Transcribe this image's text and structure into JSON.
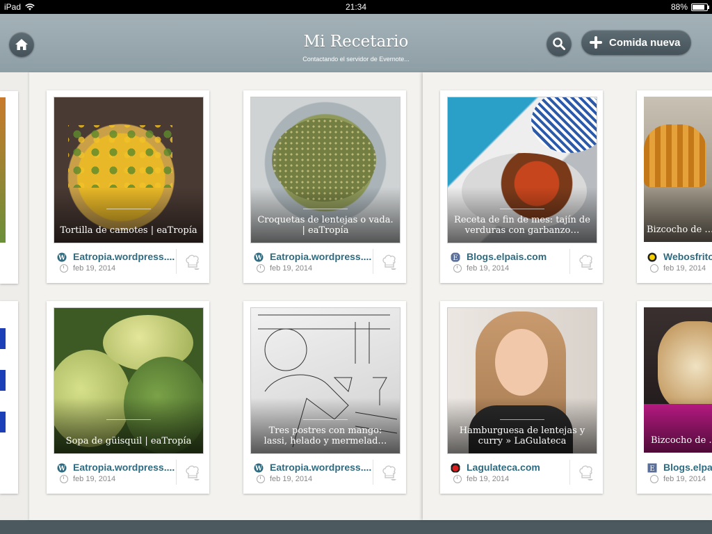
{
  "status_bar": {
    "device": "iPad",
    "time": "21:34",
    "battery": "88%",
    "battery_level": 0.88
  },
  "header": {
    "title": "Mi Recetario",
    "subtitle": "Contactando el servidor de Evernote...",
    "home_icon": "home-icon",
    "search_icon": "search-icon",
    "new_button_label": "Comida nueva"
  },
  "recipes": [
    {
      "caption": "Tortilla de camotes | eaTropía",
      "source": "Eatropia.wordpress....",
      "date": "feb 19, 2014",
      "source_icon": "wordpress-icon"
    },
    {
      "caption": "Croquetas de lentejas o vada. | eaTropía",
      "source": "Eatropia.wordpress....",
      "date": "feb 19, 2014",
      "source_icon": "wordpress-icon"
    },
    {
      "caption": "Receta de fin de mes: tajín de verduras con garbanzo…",
      "source": "Blogs.elpais.com",
      "date": "feb 19, 2014",
      "source_icon": "elpais-icon"
    },
    {
      "caption": "Bizcocho de … fr…",
      "source": "Webosfritos…",
      "date": "feb 19, 2014",
      "source_icon": "webosfritos-icon"
    },
    {
      "caption": "Sopa de güisquil | eaTropía",
      "source": "Eatropia.wordpress....",
      "date": "feb 19, 2014",
      "source_icon": "wordpress-icon"
    },
    {
      "caption": "Tres postres con mango: lassi, helado y mermelad…",
      "source": "Eatropia.wordpress....",
      "date": "feb 19, 2014",
      "source_icon": "wordpress-icon"
    },
    {
      "caption": "Hamburguesa de lentejas y curry » LaGulateca",
      "source": "Lagulateca.com",
      "date": "feb 19, 2014",
      "source_icon": "lagulateca-icon"
    },
    {
      "caption": "Bizcocho de … anacardos >…",
      "source": "Blogs.elpa…",
      "date": "feb 19, 2014",
      "source_icon": "elpais-icon"
    }
  ],
  "colors": {
    "header": "#98a7ad",
    "accent": "#2e6b80",
    "button": "#4f5c63"
  }
}
